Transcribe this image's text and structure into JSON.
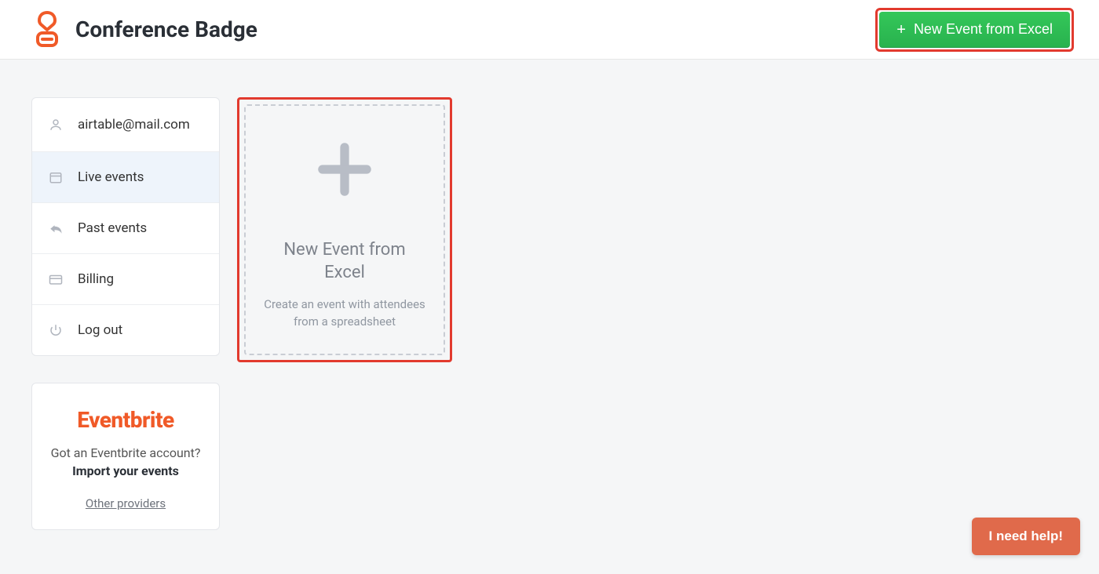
{
  "header": {
    "brand": "Conference Badge",
    "cta_label": "New Event from Excel"
  },
  "sidebar": {
    "items": [
      {
        "label": "airtable@mail.com",
        "icon": "user-icon",
        "active": false
      },
      {
        "label": "Live events",
        "icon": "calendar-icon",
        "active": true
      },
      {
        "label": "Past events",
        "icon": "reply-icon",
        "active": false
      },
      {
        "label": "Billing",
        "icon": "card-icon",
        "active": false
      },
      {
        "label": "Log out",
        "icon": "power-icon",
        "active": false
      }
    ]
  },
  "promo": {
    "brand": "Eventbrite",
    "line1": "Got an Eventbrite account?",
    "line2": "Import your events",
    "link": "Other providers"
  },
  "create_card": {
    "title": "New Event from Excel",
    "subtitle": "Create an event with attendees from a spreadsheet"
  },
  "help": {
    "label": "I need help!"
  },
  "colors": {
    "accent": "#f05a28",
    "primary_green": "#2ec052",
    "highlight_red": "#e23a2e"
  }
}
